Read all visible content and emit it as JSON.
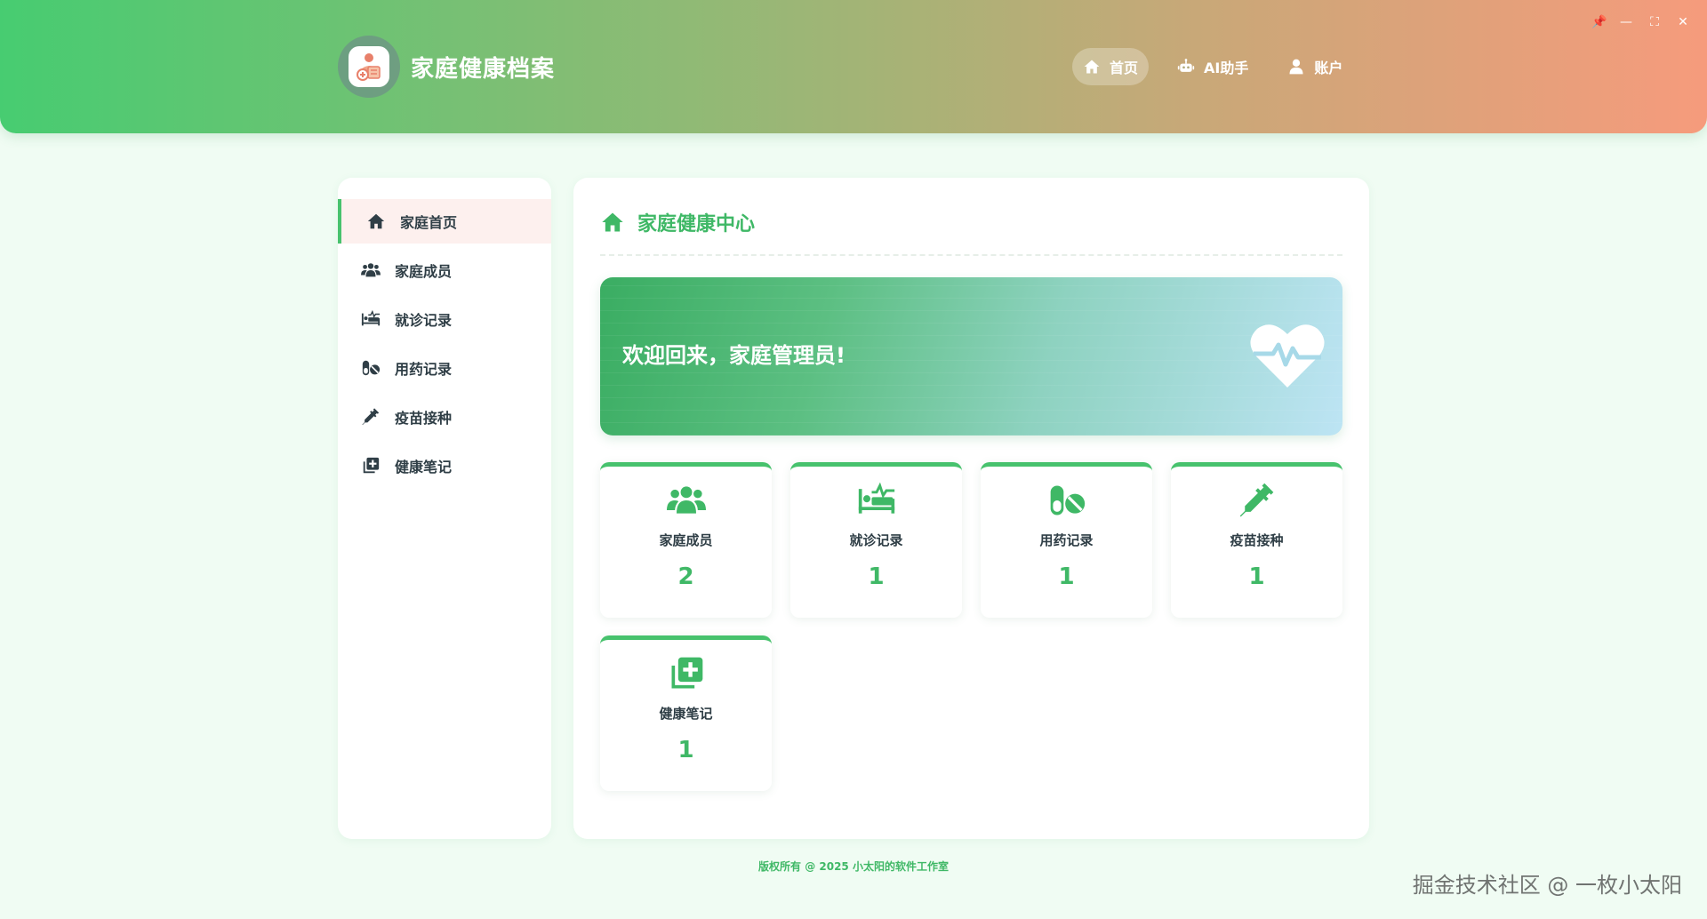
{
  "app": {
    "title": "家庭健康档案",
    "window_controls": [
      "📌",
      "—",
      "⛶",
      "✕"
    ]
  },
  "topnav": {
    "items": [
      {
        "label": "首页",
        "icon": "home-icon",
        "active": true
      },
      {
        "label": "AI助手",
        "icon": "robot-icon",
        "active": false
      },
      {
        "label": "账户",
        "icon": "user-icon",
        "active": false
      }
    ]
  },
  "sidebar": {
    "items": [
      {
        "label": "家庭首页",
        "icon": "home-icon",
        "active": true
      },
      {
        "label": "家庭成员",
        "icon": "users-icon",
        "active": false
      },
      {
        "label": "就诊记录",
        "icon": "bed-pulse-icon",
        "active": false
      },
      {
        "label": "用药记录",
        "icon": "pills-icon",
        "active": false
      },
      {
        "label": "疫苗接种",
        "icon": "syringe-icon",
        "active": false
      },
      {
        "label": "健康笔记",
        "icon": "notes-medical-icon",
        "active": false
      }
    ]
  },
  "main": {
    "title": "家庭健康中心",
    "banner_text": "欢迎回来，家庭管理员!",
    "cards": [
      {
        "label": "家庭成员",
        "value": "2",
        "icon": "users-icon"
      },
      {
        "label": "就诊记录",
        "value": "1",
        "icon": "bed-pulse-icon"
      },
      {
        "label": "用药记录",
        "value": "1",
        "icon": "pills-icon"
      },
      {
        "label": "疫苗接种",
        "value": "1",
        "icon": "syringe-icon"
      },
      {
        "label": "健康笔记",
        "value": "1",
        "icon": "notes-medical-icon"
      }
    ]
  },
  "footer": {
    "copyright": "版权所有 @ 2025 小太阳的软件工作室",
    "watermark": "掘金技术社区 @ 一枚小太阳"
  },
  "colors": {
    "accent": "#3fb866",
    "header_start": "#47cc71",
    "header_end": "#f69b7c",
    "background": "#f0fcf3"
  }
}
